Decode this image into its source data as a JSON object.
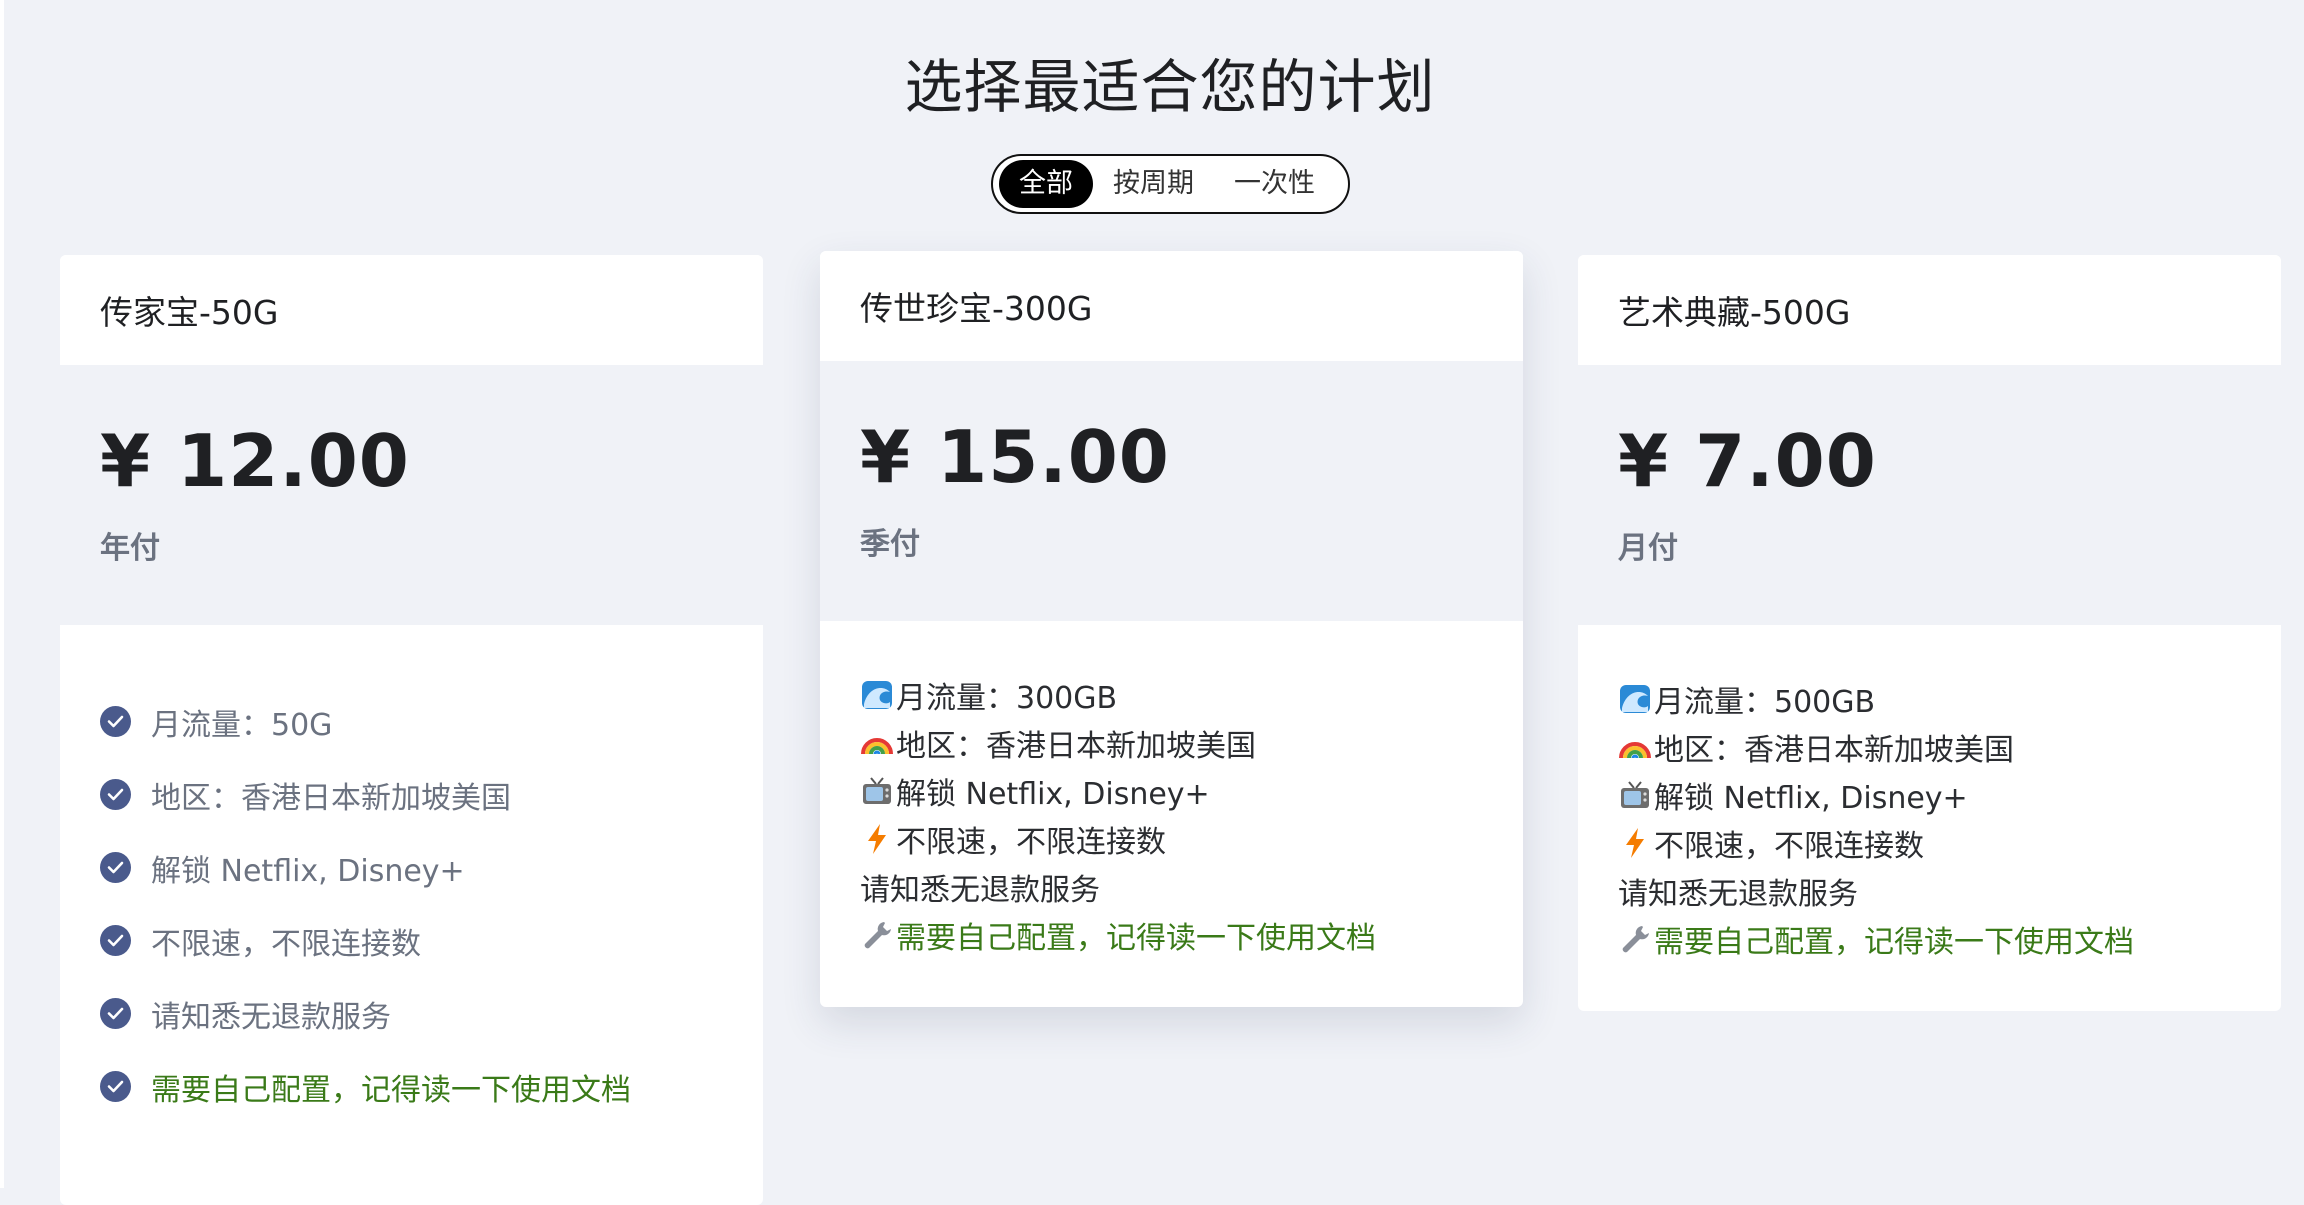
{
  "title": "选择最适合您的计划",
  "filter": {
    "options": [
      "全部",
      "按周期",
      "一次性"
    ],
    "selected": "全部"
  },
  "colors": {
    "background": "#f0f2f7",
    "check": "#4a5a8c",
    "green_text": "#3a7a18",
    "toggle_active": "#000000"
  },
  "plans": [
    {
      "name": "传家宝-50G",
      "price": "¥ 12.00",
      "period": "年付",
      "features": [
        {
          "icon": "check-circle-icon",
          "text": "月流量：50G"
        },
        {
          "icon": "check-circle-icon",
          "text": "地区：香港日本新加坡美国"
        },
        {
          "icon": "check-circle-icon",
          "text": "解锁 Netflix, Disney+"
        },
        {
          "icon": "check-circle-icon",
          "text": "不限速，不限连接数"
        },
        {
          "icon": "check-circle-icon",
          "text": "请知悉无退款服务"
        },
        {
          "icon": "check-circle-icon",
          "text": "需要自己配置，记得读一下使用文档"
        }
      ]
    },
    {
      "name": "传世珍宝-300G",
      "price": "¥ 15.00",
      "period": "季付",
      "features": [
        {
          "icon": "wave-icon",
          "text": "月流量：300GB"
        },
        {
          "icon": "rainbow-icon",
          "text": "地区：香港日本新加坡美国"
        },
        {
          "icon": "tv-icon",
          "text": "解锁 Netflix, Disney+"
        },
        {
          "icon": "lightning-icon",
          "text": "不限速，不限连接数"
        },
        {
          "icon": "",
          "text": "请知悉无退款服务"
        },
        {
          "icon": "wrench-icon",
          "text": "需要自己配置，记得读一下使用文档"
        }
      ]
    },
    {
      "name": "艺术典藏-500G",
      "price": "¥ 7.00",
      "period": "月付",
      "features": [
        {
          "icon": "wave-icon",
          "text": "月流量：500GB"
        },
        {
          "icon": "rainbow-icon",
          "text": "地区：香港日本新加坡美国"
        },
        {
          "icon": "tv-icon",
          "text": "解锁 Netflix, Disney+"
        },
        {
          "icon": "lightning-icon",
          "text": "不限速，不限连接数"
        },
        {
          "icon": "",
          "text": "请知悉无退款服务"
        },
        {
          "icon": "wrench-icon",
          "text": "需要自己配置，记得读一下使用文档"
        }
      ]
    }
  ]
}
